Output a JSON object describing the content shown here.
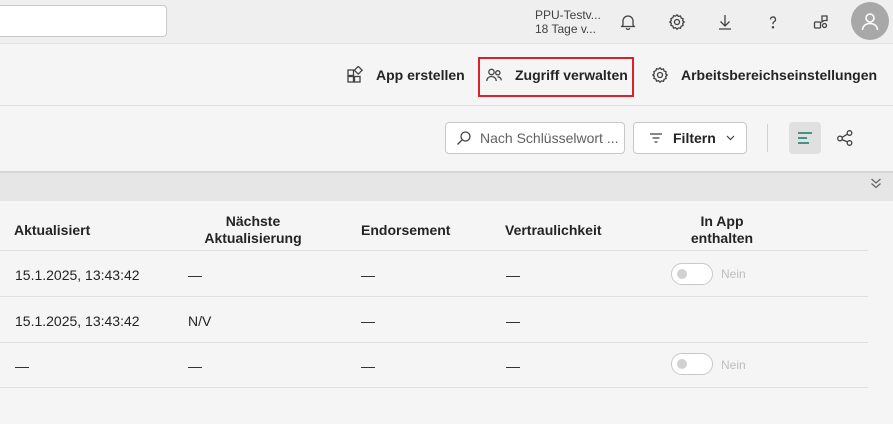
{
  "topbar": {
    "trial_line1": "PPU-Testv...",
    "trial_line2": "18 Tage v...",
    "icons": [
      "bell-icon",
      "gear-icon",
      "download-icon",
      "help-icon",
      "feedback-icon",
      "avatar-icon"
    ]
  },
  "actions": {
    "create_app": "App erstellen",
    "manage_access": "Zugriff verwalten",
    "workspace_settings": "Arbeitsbereichseinstellungen",
    "highlight_color": "#d8232f"
  },
  "filterbar": {
    "search_placeholder": "Nach Schlüsselwort ...",
    "filter_label": "Filtern"
  },
  "table": {
    "headers": {
      "updated": "Aktualisiert",
      "next_refresh_line1": "Nächste",
      "next_refresh_line2": "Aktualisierung",
      "endorsement": "Endorsement",
      "sensitivity": "Vertraulichkeit",
      "in_app_line1": "In App",
      "in_app_line2": "enthalten"
    },
    "rows": [
      {
        "updated": "15.1.2025, 13:43:42",
        "next": "—",
        "endorsement": "—",
        "sensitivity": "—",
        "in_app": "Nein"
      },
      {
        "updated": "15.1.2025, 13:43:42",
        "next": "N/V",
        "endorsement": "—",
        "sensitivity": "—",
        "in_app": ""
      },
      {
        "updated": "—",
        "next": "—",
        "endorsement": "—",
        "sensitivity": "—",
        "in_app": "Nein"
      }
    ]
  }
}
